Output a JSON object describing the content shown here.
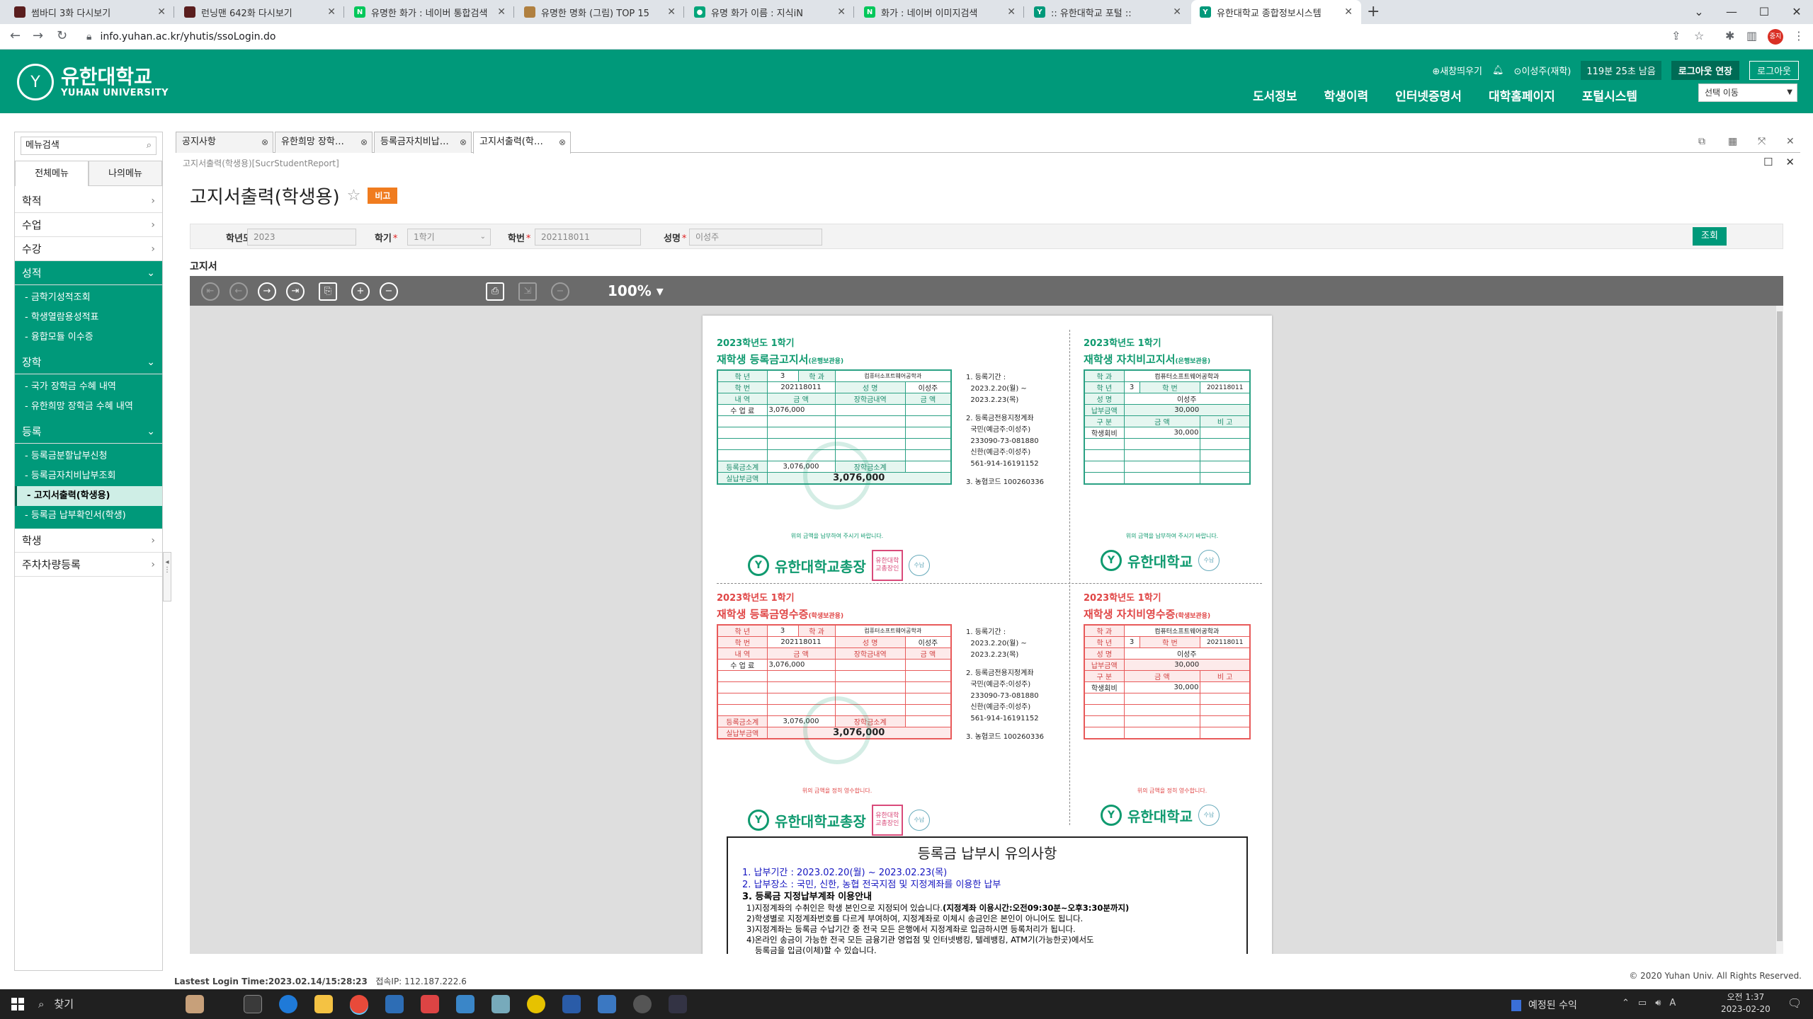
{
  "browser": {
    "tabs": [
      {
        "title": "썸바디 3화 다시보기",
        "color": "#5a1e1e"
      },
      {
        "title": "런닝맨 642화 다시보기",
        "color": "#5a1e1e"
      },
      {
        "title": "유명한 화가 : 네이버 통합검색",
        "color": "#03c75a"
      },
      {
        "title": "유명한 명화 (그림) TOP 15",
        "color": "#b08040"
      },
      {
        "title": "유명 화가 이름 : 지식iN",
        "color": "#03a57a"
      },
      {
        "title": "화가 : 네이버 이미지검색",
        "color": "#03c75a"
      },
      {
        "title": ":: 유한대학교 포털 ::",
        "color": "#00997a"
      },
      {
        "title": "유한대학교 종합정보시스템",
        "color": "#00997a"
      }
    ],
    "new_tab": "+",
    "url": "info.yuhan.ac.kr/yhutis/ssoLogin.do",
    "profile": "중지"
  },
  "header": {
    "school_kr": "유한대학교",
    "school_en": "YUHAN UNIVERSITY",
    "util": {
      "new_window": "⊕새창띄우기",
      "user": "⊙이성주(재학)",
      "timer": "119분 25초 남음",
      "extend": "로그아웃 연장",
      "logout": "로그아웃"
    },
    "nav": [
      "도서정보",
      "학생이력",
      "인터넷증명서",
      "대학홈페이지",
      "포털시스템"
    ],
    "move_select": "선택 이동"
  },
  "sidebar": {
    "search_placeholder": "메뉴검색",
    "tabs": [
      "전체메뉴",
      "나의메뉴"
    ],
    "menu": [
      {
        "label": "학적",
        "open": false,
        "sub": []
      },
      {
        "label": "수업",
        "open": false,
        "sub": []
      },
      {
        "label": "수강",
        "open": false,
        "sub": []
      },
      {
        "label": "성적",
        "open": true,
        "sub": [
          "- 금학기성적조회",
          "- 학생열람용성적표",
          "- 융합모듈 이수증"
        ]
      },
      {
        "label": "장학",
        "open": true,
        "sub": [
          "- 국가 장학금 수혜 내역",
          "- 유한희망 장학금 수혜 내역"
        ]
      },
      {
        "label": "등록",
        "open": true,
        "sub": [
          "- 등록금분할납부신청",
          "- 등록금자치비납부조회",
          "- 고지서출력(학생용)",
          "- 등록금 납부확인서(학생)"
        ],
        "selected": 2
      },
      {
        "label": "학생",
        "open": false,
        "sub": []
      },
      {
        "label": "주차차량등록",
        "open": false,
        "sub": []
      }
    ]
  },
  "content": {
    "tabs": [
      "공지사항",
      "유한희망 장학…",
      "등록금자치비납…",
      "고지서출력(학…"
    ],
    "active_tab": 3,
    "breadcrumb": "고지서출력(학생용)[SucrStudentReport]",
    "title": "고지서출력(학생용)",
    "badge": "비고",
    "form": {
      "year_label": "학년도",
      "year": "2023",
      "term_label": "학기",
      "term": "1학기",
      "id_label": "학번",
      "id": "202118011",
      "name_label": "성명",
      "name": "이성주",
      "search_btn": "조회"
    },
    "section": "고지서",
    "viewer": {
      "zoom": "100%"
    }
  },
  "report": {
    "year": "2023학년도  1학기",
    "tuition_bill_title": "재학생 등록금고지서",
    "fee_bill_title": "재학생 자치비고지서",
    "tuition_receipt_title": "재학생 등록금영수증",
    "fee_receipt_title": "재학생 자치비영수증",
    "copy_for": "(은행보관용)",
    "copy_student": "(학생보관용)",
    "labels": {
      "grade": "학   년",
      "dept": "학   과",
      "student_id": "학   번",
      "name": "성   명",
      "detail": "내   역",
      "amount": "금   액",
      "scholarship_detail": "장학금내역",
      "tuition": "수 업 료",
      "subtotal": "등록금소계",
      "scholar_subtotal": "장학금소계",
      "actual": "실납부금액",
      "pay_amount": "납부금액",
      "category": "구   분",
      "remark": "비   고",
      "student_fee": "학생회비"
    },
    "values": {
      "grade": "3",
      "dept": "컴퓨터소프트웨어공학과",
      "student_id": "202118011",
      "name": "이성주",
      "tuition": "3,076,000",
      "subtotal": "3,076,000",
      "actual": "3,076,000",
      "fee": "30,000"
    },
    "notes": {
      "period_label": "1. 등록기간 :",
      "period": "2023.2.20(월) ~",
      "period_end": "2023.2.23(목)",
      "account_label": "2. 등록금전용지정계좌",
      "acc1": "국민(예금주:이성주)",
      "acc1_no": "233090-73-081880",
      "acc2": "신한(예금주:이성주)",
      "acc2_no": "561-914-16191152",
      "code": "3. 농협코드 100260336"
    },
    "pay_note": "위의 금액을 납부하여 주시기 바랍니다.",
    "recv_note": "위의 금액을 정히 영수합니다.",
    "president": "유한대학교총장",
    "school": "유한대학교",
    "seal_text": "유한대학교총장인",
    "stamp": "수납",
    "notice": {
      "title": "등록금  납부시  유의사항",
      "l1": "1. 납부기간 : 2023.02.20(월) ~ 2023.02.23(목)",
      "l2": "2. 납부장소 : 국민, 신한, 농협 전국지점 및 지정계좌를 이용한 납부",
      "l3": "3. 등록금 지정납부계좌 이용안내",
      "r1a": "1)지정계좌의 수취인은 학생 본인으로 지정되어 있습니다.",
      "r1b": "(지정계좌 이용시간:오전09:30분~오후3:30분까지)",
      "r2": "2)학생별로 지정계좌번호를 다르게 부여하여, 지정계좌로 이체시 송금인은 본인이 아니어도 됩니다.",
      "r3": "3)지정계좌는 등록금 수납기간 중 전국 모든 은행에서 지정계좌로 입금하시면 등록처리가 됩니다.",
      "r4": "4)온라인 송금이 가능한 전국 모든 금융기관 영업점 및 인터넷뱅킹, 텔레뱅킹, ATM기(가능한곳)에서도",
      "r4b": "등록금을 입금(이체)할 수 있습니다."
    }
  },
  "footer": {
    "last_login": "Lastest Login Time:2023.02.14/15:28:23",
    "ip": "접속IP: 112.187.222.6",
    "copyright": "© 2020 Yuhan Univ. All Rights Reserved."
  },
  "taskbar": {
    "search": "찾기",
    "weather": "예정된 수익",
    "time": "오전 1:37",
    "date": "2023-02-20"
  }
}
